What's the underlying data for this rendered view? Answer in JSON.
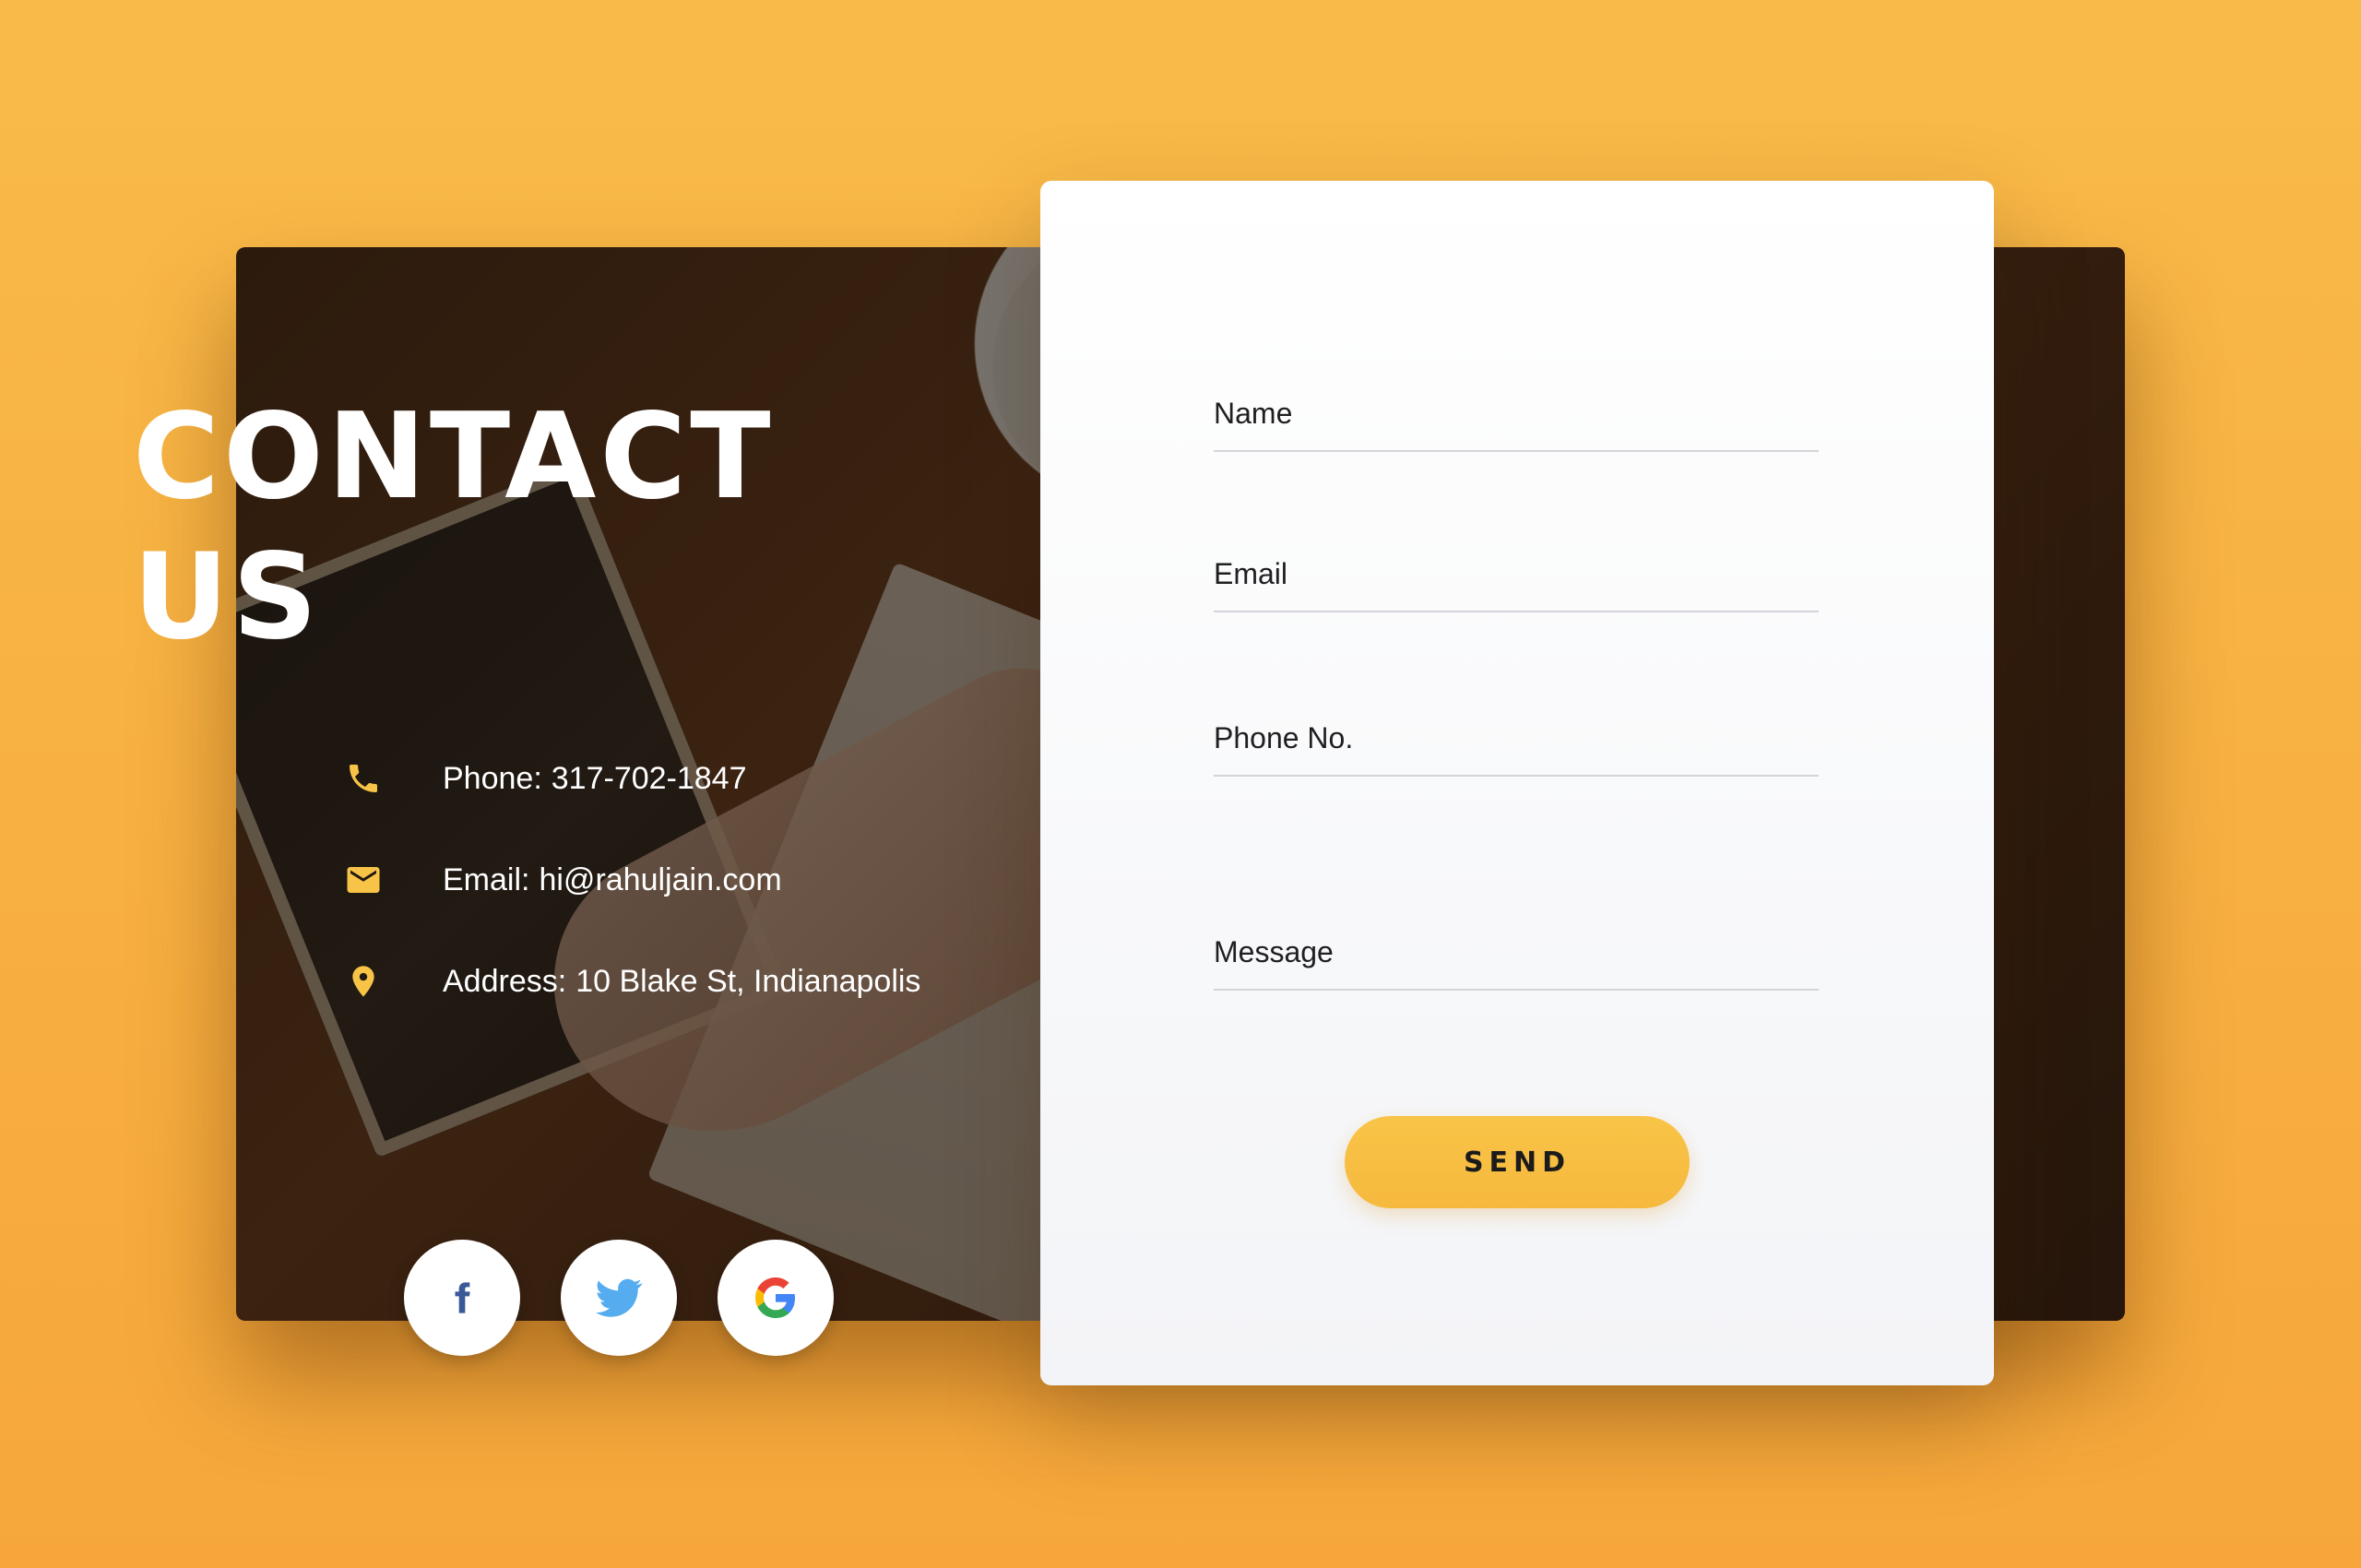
{
  "heading": {
    "line1": "CONTACT",
    "line2": "US"
  },
  "contact_info": {
    "phone": {
      "label": "Phone:",
      "value": "317-702-1847",
      "icon": "phone-icon"
    },
    "email": {
      "label": "Email:",
      "value": "hi@rahuljain.com",
      "icon": "mail-icon"
    },
    "address": {
      "label": "Address:",
      "value": "10 Blake St, Indianapolis",
      "icon": "location-pin-icon"
    }
  },
  "socials": [
    {
      "name": "facebook",
      "icon": "facebook-icon"
    },
    {
      "name": "twitter",
      "icon": "twitter-icon"
    },
    {
      "name": "google",
      "icon": "google-icon"
    }
  ],
  "form": {
    "name_label": "Name",
    "email_label": "Email",
    "phone_label": "Phone No.",
    "message_label": "Message",
    "send_label": "SEND"
  },
  "colors": {
    "accent": "#f8c447",
    "background_top": "#f9bb48",
    "background_bottom": "#f7a73a",
    "facebook": "#3b5998",
    "twitter": "#55acee"
  }
}
